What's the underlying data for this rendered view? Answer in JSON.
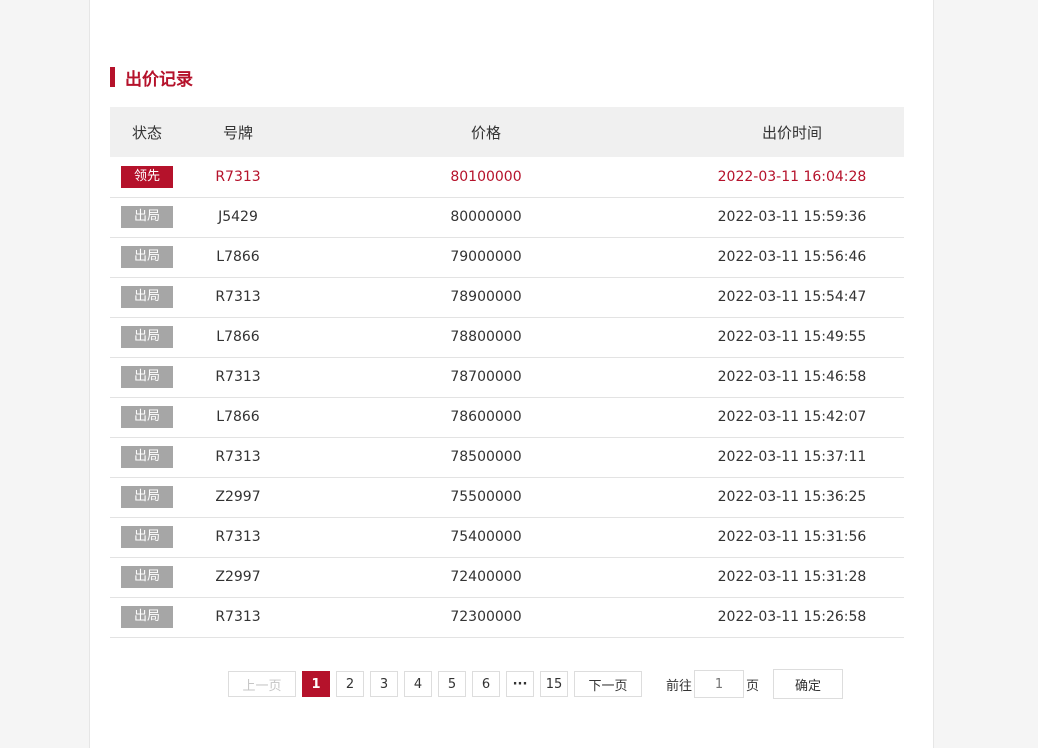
{
  "section": {
    "title": "出价记录"
  },
  "table": {
    "headers": {
      "status": "状态",
      "plate": "号牌",
      "price": "价格",
      "time": "出价时间"
    },
    "rows": [
      {
        "status": "领先",
        "plate": "R7313",
        "price": "80100000",
        "time": "2022-03-11 16:04:28"
      },
      {
        "status": "出局",
        "plate": "J5429",
        "price": "80000000",
        "time": "2022-03-11 15:59:36"
      },
      {
        "status": "出局",
        "plate": "L7866",
        "price": "79000000",
        "time": "2022-03-11 15:56:46"
      },
      {
        "status": "出局",
        "plate": "R7313",
        "price": "78900000",
        "time": "2022-03-11 15:54:47"
      },
      {
        "status": "出局",
        "plate": "L7866",
        "price": "78800000",
        "time": "2022-03-11 15:49:55"
      },
      {
        "status": "出局",
        "plate": "R7313",
        "price": "78700000",
        "time": "2022-03-11 15:46:58"
      },
      {
        "status": "出局",
        "plate": "L7866",
        "price": "78600000",
        "time": "2022-03-11 15:42:07"
      },
      {
        "status": "出局",
        "plate": "R7313",
        "price": "78500000",
        "time": "2022-03-11 15:37:11"
      },
      {
        "status": "出局",
        "plate": "Z2997",
        "price": "75500000",
        "time": "2022-03-11 15:36:25"
      },
      {
        "status": "出局",
        "plate": "R7313",
        "price": "75400000",
        "time": "2022-03-11 15:31:56"
      },
      {
        "status": "出局",
        "plate": "Z2997",
        "price": "72400000",
        "time": "2022-03-11 15:31:28"
      },
      {
        "status": "出局",
        "plate": "R7313",
        "price": "72300000",
        "time": "2022-03-11 15:26:58"
      }
    ]
  },
  "pagination": {
    "prev_label": "上一页",
    "next_label": "下一页",
    "pages": [
      "1",
      "2",
      "3",
      "4",
      "5",
      "6"
    ],
    "current_page": "1",
    "ellipsis": "···",
    "last_page": "15",
    "goto_label": "前往",
    "goto_placeholder": "1",
    "goto_unit": "页",
    "confirm_label": "确定"
  },
  "colors": {
    "accent": "#b5122b",
    "badge_out": "#a6a6a6",
    "header_bg": "#f0f0f0",
    "page_bg": "#f5f5f5"
  }
}
